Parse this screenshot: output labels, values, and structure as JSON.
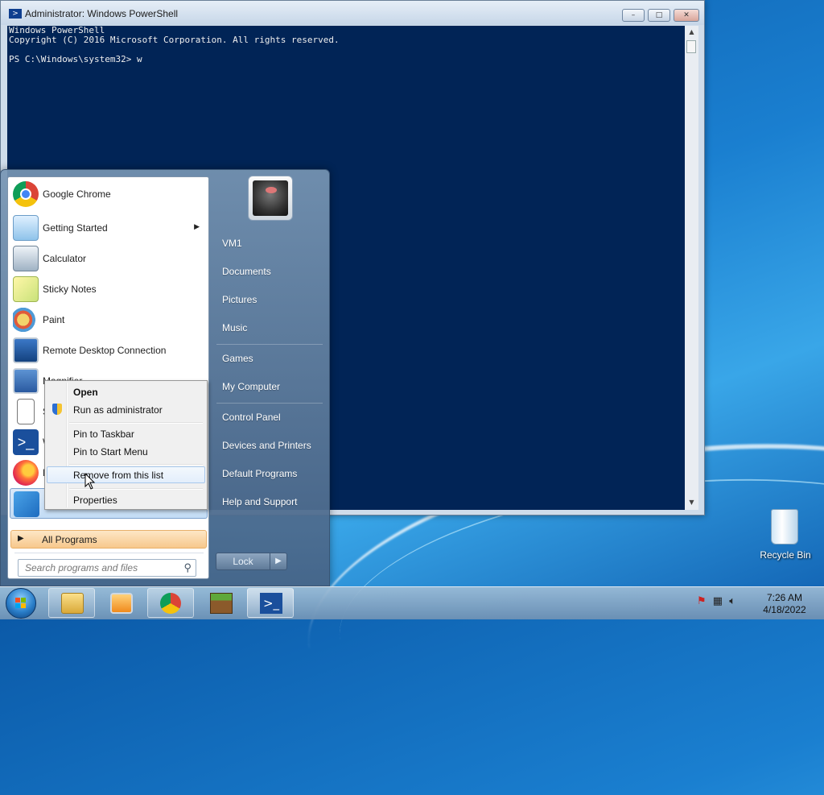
{
  "powershell": {
    "title": "Administrator: Windows PowerShell",
    "lines": [
      "Windows PowerShell",
      "Copyright (C) 2016 Microsoft Corporation. All rights reserved.",
      "",
      "PS C:\\Windows\\system32> w"
    ],
    "buttons": {
      "minimize": "–",
      "maximize": "□",
      "close": "✕"
    }
  },
  "start_menu": {
    "programs": [
      {
        "label": "Google Chrome",
        "icon": "chrome-icon"
      },
      {
        "label": "Getting Started",
        "icon": "getting-started-icon",
        "has_submenu": true
      },
      {
        "label": "Calculator",
        "icon": "calculator-icon"
      },
      {
        "label": "Sticky Notes",
        "icon": "sticky-notes-icon"
      },
      {
        "label": "Paint",
        "icon": "paint-icon"
      },
      {
        "label": "Remote Desktop Connection",
        "icon": "remote-desktop-icon"
      },
      {
        "label": "Magnifier",
        "icon": "magnifier-icon"
      },
      {
        "label": "S",
        "icon": "solitaire-icon"
      },
      {
        "label": "W",
        "icon": "powershell-icon"
      },
      {
        "label": "F",
        "icon": "firefox-icon"
      },
      {
        "label": "F",
        "icon": "generic-app-icon"
      }
    ],
    "all_programs": "All Programs",
    "search_placeholder": "Search programs and files",
    "right_items": [
      "VM1",
      "Documents",
      "Pictures",
      "Music",
      "Games",
      "My Computer",
      "Control Panel",
      "Devices and Printers",
      "Default Programs",
      "Help and Support"
    ],
    "lock_label": "Lock",
    "submenu_arrow": "▶",
    "lock_arrow": "▶"
  },
  "context_menu": {
    "items": [
      "Open",
      "Run as administrator",
      "Pin to Taskbar",
      "Pin to Start Menu",
      "Remove from this list",
      "Properties"
    ],
    "hovered": "Remove from this list"
  },
  "desktop": {
    "recycle_bin_label": "Recycle Bin"
  },
  "taskbar": {
    "time": "7:26 AM",
    "date": "4/18/2022",
    "pinned": [
      "explorer-icon",
      "media-player-icon",
      "chrome-icon",
      "minecraft-icon",
      "powershell-icon"
    ]
  },
  "colors": {
    "console_bg": "#012456",
    "console_fg": "#eeeeee",
    "all_programs_bg": "#f7c88c"
  }
}
